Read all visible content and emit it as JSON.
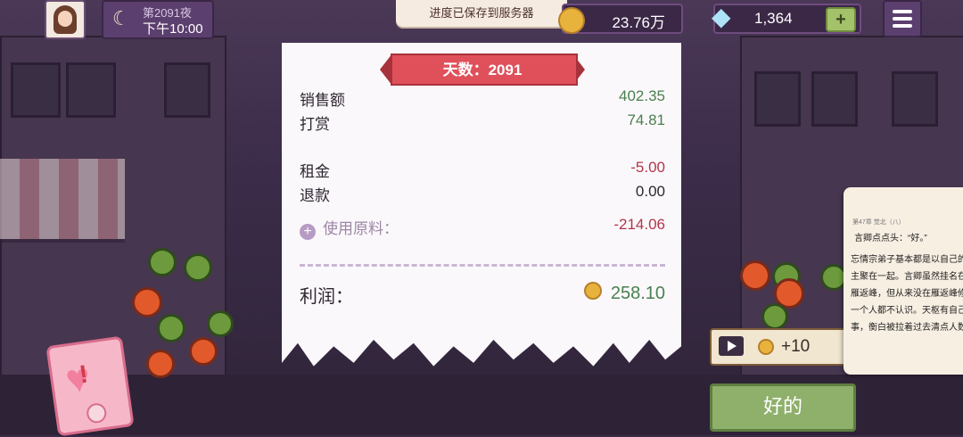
{
  "hud": {
    "night_label": "第2091夜",
    "time": "下午10:00",
    "toast": "进度已保存到服务器",
    "coins": "23.76万",
    "gems": "1,364",
    "add_gems": "+"
  },
  "receipt": {
    "day_title": "天数：2091",
    "sales_label": "销售额",
    "sales_value": "402.35",
    "tips_label": "打赏",
    "tips_value": "74.81",
    "rent_label": "租金",
    "rent_value": "-5.00",
    "refund_label": "退款",
    "refund_value": "0.00",
    "ingredients_label": "使用原料：",
    "ingredients_value": "-214.06",
    "profit_label": "利润：",
    "profit_value": "258.10"
  },
  "reward": {
    "value": "+10"
  },
  "ok_button": "好的",
  "novel": {
    "header": "第47章 觉北（八）",
    "quote": "言卿点点头：“好。”",
    "paragraph": "忘情宗弟子基本都是以自己的峰头为主聚在一起。言卿虽然挂名在天枢的雁返峰，但从来没在雁返峰修行过，一个人都不认识。天枢有自己负责的事，衡白被拉着过去清点人数。"
  },
  "colors": {
    "positive": "#4a8050",
    "negative": "#b0364a",
    "ribbon": "#e0505b",
    "ok_button": "#8fb06b"
  }
}
